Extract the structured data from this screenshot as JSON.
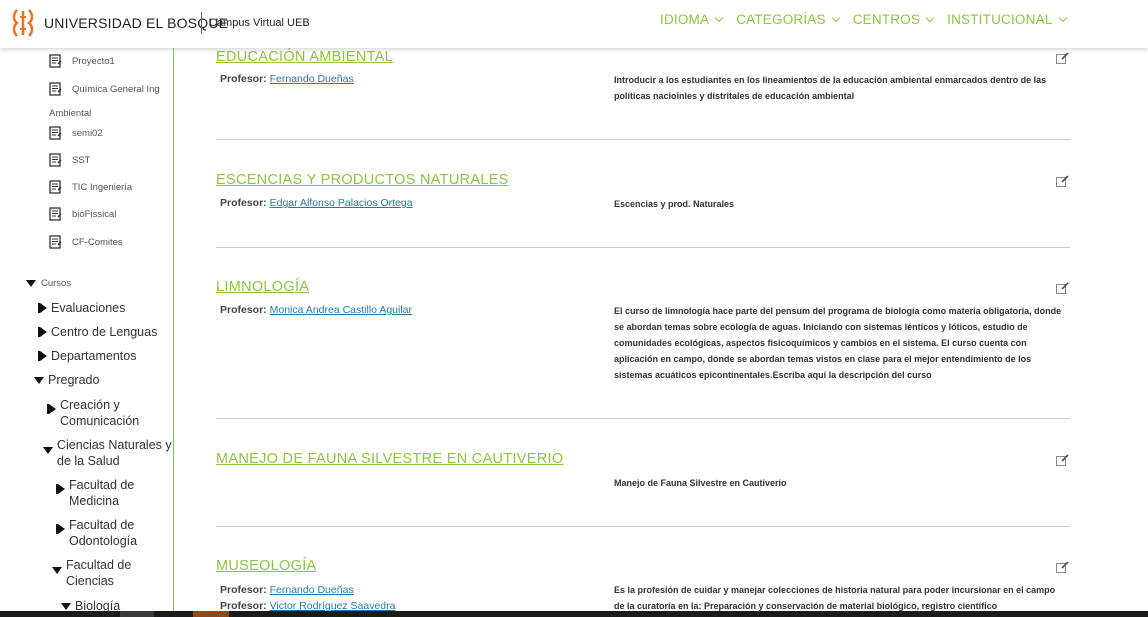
{
  "header": {
    "brand": "UNIVERSIDAD EL BOSQUE",
    "subtitle": "Campus Virtual UEB",
    "nav": [
      "IDIOMA",
      "CATEGORÍAS",
      "CENTROS",
      "INSTITUCIONAL"
    ]
  },
  "sidebar": {
    "projects": [
      "Proyecto1",
      "Química General Ing",
      "semi02",
      "SST",
      "TIC Ingeniería",
      "bioFissical",
      "CF-Comites"
    ],
    "wrap_text": "Ambiental",
    "cursos_label": "Cursos",
    "tree": [
      {
        "label": "Evaluaciones",
        "state": "collapsed"
      },
      {
        "label": "Centro de Lenguas",
        "state": "collapsed"
      },
      {
        "label": "Departamentos",
        "state": "collapsed"
      },
      {
        "label": "Pregrado",
        "state": "expanded"
      },
      {
        "label": "Creación y Comunicación",
        "state": "collapsed"
      },
      {
        "label": "Ciencias Naturales y de la Salud",
        "state": "expanded"
      },
      {
        "label": "Facultad de Medicina",
        "state": "collapsed"
      },
      {
        "label": "Facultad de Odontología",
        "state": "collapsed"
      },
      {
        "label": "Facultad de Ciencias",
        "state": "expanded"
      },
      {
        "label": "Biología",
        "state": "expanded"
      }
    ]
  },
  "courses": [
    {
      "title": "EDUCACIÓN AMBIENTAL",
      "prof_label": "Profesor:",
      "professors": [
        "Fernando Dueñas"
      ],
      "description": "Introducir a los estudiantes en los lineamientos de la educación ambiental enmarcados dentro de las políticas nacioinles y distritales de educación ambiental"
    },
    {
      "title": "ESCENCIAS Y PRODUCTOS NATURALES",
      "prof_label": "Profesor:",
      "professors": [
        "Edgar Alfonso Palacios Ortega"
      ],
      "description": "Escencias y prod. Naturales"
    },
    {
      "title": "LIMNOLOGÍA",
      "prof_label": "Profesor:",
      "professors": [
        "Monica Andrea Castillo Aguilar"
      ],
      "description": "El curso de limnología hace parte del pensum del programa de biología como materia obligatoria, donde se abordan temas sobre ecología de aguas. Iniciando con sistemas lénticos y lóticos, estudio de comunidades ecológicas, aspectos fisicoquímicos y cambios en el sistema. El curso cuenta con aplicación en campo, donde se abordan temas vistos en clase para el mejor entendimiento de los sistemas acuáticos epicontinentales.Escriba aquí la descripción del curso"
    },
    {
      "title": "MANEJO DE FAUNA SILVESTRE EN CAUTIVERIO",
      "prof_label": "",
      "professors": [],
      "description": "Manejo de Fauna Silvestre en Cautiverio"
    },
    {
      "title": "MUSEOLOGÍA",
      "prof_label": "Profesor:",
      "professors": [
        "Fernando Dueñas",
        "Victor Rodríguez Saavedra"
      ],
      "description": "Es la profesión de cuidar y manejar colecciones de historia natural  para poder incursionar en el campo de  la  curatoría en  la: Preparación y conservación de material biológico, registro científico"
    }
  ],
  "colors": {
    "accent": "#8dc63f",
    "link": "#2a7aa0",
    "logo": "#e8742a"
  }
}
